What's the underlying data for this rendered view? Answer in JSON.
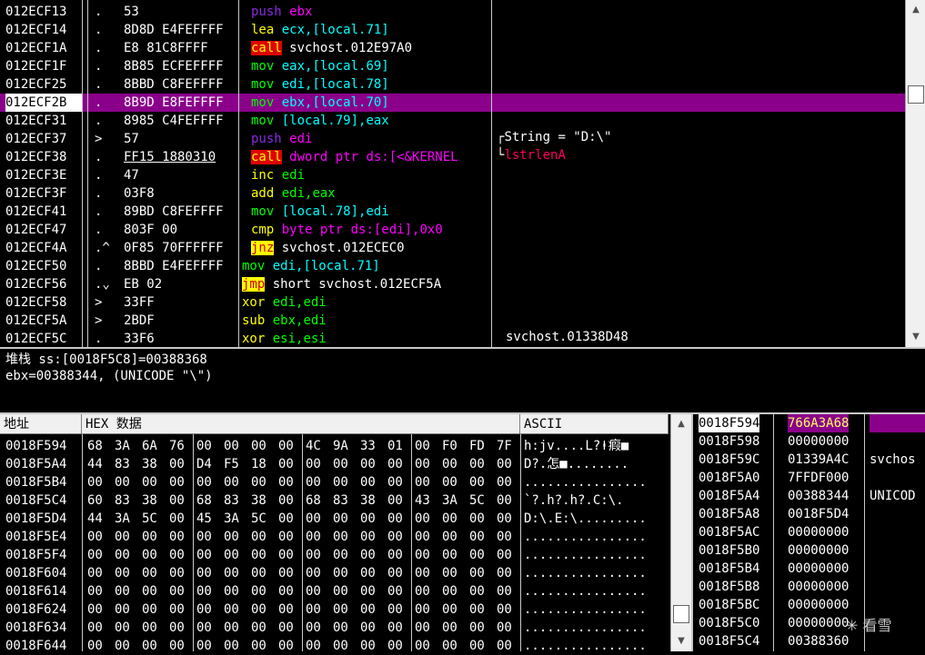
{
  "cpu": {
    "rows": [
      {
        "addr": "012ECF13",
        "mark": ".",
        "hex": "53",
        "op": "push",
        "opclass": "op-push",
        "args": "ebx",
        "argclass": "arg-mag"
      },
      {
        "addr": "012ECF14",
        "mark": ".",
        "hex": "8D8D E4FEFFFF",
        "op": "lea",
        "opclass": "op-cmp",
        "args": "ecx,[local.71]",
        "argclass": "arg-cyan"
      },
      {
        "addr": "012ECF1A",
        "mark": ".",
        "hex": "E8 81C8FFFF",
        "op": "call",
        "opclass": "op-call",
        "args": "svchost.012E97A0",
        "argclass": "arg-white"
      },
      {
        "addr": "012ECF1F",
        "mark": ".",
        "hex": "8B85 ECFEFFFF",
        "op": "mov",
        "opclass": "op-green",
        "args": "eax,[local.69]",
        "argclass": "arg-cyan"
      },
      {
        "addr": "012ECF25",
        "mark": ".",
        "hex": "8BBD C8FEFFFF",
        "op": "mov",
        "opclass": "op-green",
        "args": "edi,[local.78]",
        "argclass": "arg-cyan"
      },
      {
        "addr": "012ECF2B",
        "mark": ".",
        "hex": "8B9D E8FEFFFF",
        "op": "mov",
        "opclass": "op-green",
        "args": "ebx,[local.70]",
        "argclass": "arg-cyan"
      },
      {
        "addr": "012ECF31",
        "mark": ".",
        "hex": "8985 C4FEFFFF",
        "op": "mov",
        "opclass": "op-green",
        "args": "[local.79],eax",
        "argclass": "arg-cyan"
      },
      {
        "addr": "012ECF37",
        "mark": ">",
        "hex": "57",
        "op": "push",
        "opclass": "op-push",
        "args": "edi",
        "argclass": "arg-mag"
      },
      {
        "addr": "012ECF38",
        "mark": ".",
        "hex": "FF15 1880310",
        "op": "call",
        "opclass": "op-call",
        "args": "dword ptr ds:[<&KERNEL",
        "argclass": "arg-mag"
      },
      {
        "addr": "012ECF3E",
        "mark": ".",
        "hex": "47",
        "op": "inc",
        "opclass": "op-cmp",
        "args": "edi",
        "argclass": "arg-green"
      },
      {
        "addr": "012ECF3F",
        "mark": ".",
        "hex": "03F8",
        "op": "add",
        "opclass": "op-cmp",
        "args": "edi,eax",
        "argclass": "arg-green"
      },
      {
        "addr": "012ECF41",
        "mark": ".",
        "hex": "89BD C8FEFFFF",
        "op": "mov",
        "opclass": "op-green",
        "args": "[local.78],edi",
        "argclass": "arg-cyan"
      },
      {
        "addr": "012ECF47",
        "mark": ".",
        "hex": "803F 00",
        "op": "cmp",
        "opclass": "op-cmp",
        "args": "byte ptr ds:[edi],0x0",
        "argclass": "arg-mag"
      },
      {
        "addr": "012ECF4A",
        "mark": ".^",
        "hex": "0F85 70FFFFFF",
        "op": "jnz",
        "opclass": "op-jmp",
        "args": "svchost.012ECEC0",
        "argclass": "arg-white"
      },
      {
        "addr": "012ECF50",
        "mark": ".",
        "hex": "8BBD E4FEFFFF",
        "op": "mov",
        "opclass": "op-green",
        "args": "edi,[local.71]",
        "argclass": "arg-cyan"
      },
      {
        "addr": "012ECF56",
        "mark": ".⌄",
        "hex": "EB 02",
        "op": "jmp",
        "opclass": "op-jmp",
        "args": "short svchost.012ECF5A",
        "argclass": "arg-white"
      },
      {
        "addr": "012ECF58",
        "mark": ">",
        "hex": "33FF",
        "op": "xor",
        "opclass": "op-cmp",
        "args": "edi,edi",
        "argclass": "arg-green"
      },
      {
        "addr": "012ECF5A",
        "mark": ">",
        "hex": "2BDF",
        "op": "sub",
        "opclass": "op-cmp",
        "args": "ebx,edi",
        "argclass": "arg-green"
      },
      {
        "addr": "012ECF5C",
        "mark": ".",
        "hex": "33F6",
        "op": "xor",
        "opclass": "op-cmp",
        "args": "esi,esi",
        "argclass": "arg-green"
      }
    ],
    "comment_string": "String = \"D:\\\"",
    "comment_func": "lstrlenA",
    "comment_bottom": "svchost.01338D48"
  },
  "info": {
    "line1": "堆栈 ss:[0018F5C8]=00388368",
    "line2": "ebx=00388344, (UNICODE \"\\\")"
  },
  "dump": {
    "header_addr": "地址",
    "header_hex": "HEX 数据",
    "header_ascii": "ASCII",
    "rows": [
      {
        "addr": "0018F594",
        "bytes": [
          "68",
          "3A",
          "6A",
          "76",
          "00",
          "00",
          "00",
          "00",
          "4C",
          "9A",
          "33",
          "01",
          "00",
          "F0",
          "FD",
          "7F"
        ],
        "ascii": "h:jv....L?ⱡ瘕■"
      },
      {
        "addr": "0018F5A4",
        "bytes": [
          "44",
          "83",
          "38",
          "00",
          "D4",
          "F5",
          "18",
          "00",
          "00",
          "00",
          "00",
          "00",
          "00",
          "00",
          "00",
          "00"
        ],
        "ascii": "D?.怎■........"
      },
      {
        "addr": "0018F5B4",
        "bytes": [
          "00",
          "00",
          "00",
          "00",
          "00",
          "00",
          "00",
          "00",
          "00",
          "00",
          "00",
          "00",
          "00",
          "00",
          "00",
          "00"
        ],
        "ascii": "................"
      },
      {
        "addr": "0018F5C4",
        "bytes": [
          "60",
          "83",
          "38",
          "00",
          "68",
          "83",
          "38",
          "00",
          "68",
          "83",
          "38",
          "00",
          "43",
          "3A",
          "5C",
          "00"
        ],
        "ascii": "`?.h?.h?.C:\\."
      },
      {
        "addr": "0018F5D4",
        "bytes": [
          "44",
          "3A",
          "5C",
          "00",
          "45",
          "3A",
          "5C",
          "00",
          "00",
          "00",
          "00",
          "00",
          "00",
          "00",
          "00",
          "00"
        ],
        "ascii": "D:\\.E:\\........."
      },
      {
        "addr": "0018F5E4",
        "bytes": [
          "00",
          "00",
          "00",
          "00",
          "00",
          "00",
          "00",
          "00",
          "00",
          "00",
          "00",
          "00",
          "00",
          "00",
          "00",
          "00"
        ],
        "ascii": "................"
      },
      {
        "addr": "0018F5F4",
        "bytes": [
          "00",
          "00",
          "00",
          "00",
          "00",
          "00",
          "00",
          "00",
          "00",
          "00",
          "00",
          "00",
          "00",
          "00",
          "00",
          "00"
        ],
        "ascii": "................"
      },
      {
        "addr": "0018F604",
        "bytes": [
          "00",
          "00",
          "00",
          "00",
          "00",
          "00",
          "00",
          "00",
          "00",
          "00",
          "00",
          "00",
          "00",
          "00",
          "00",
          "00"
        ],
        "ascii": "................"
      },
      {
        "addr": "0018F614",
        "bytes": [
          "00",
          "00",
          "00",
          "00",
          "00",
          "00",
          "00",
          "00",
          "00",
          "00",
          "00",
          "00",
          "00",
          "00",
          "00",
          "00"
        ],
        "ascii": "................"
      },
      {
        "addr": "0018F624",
        "bytes": [
          "00",
          "00",
          "00",
          "00",
          "00",
          "00",
          "00",
          "00",
          "00",
          "00",
          "00",
          "00",
          "00",
          "00",
          "00",
          "00"
        ],
        "ascii": "................"
      },
      {
        "addr": "0018F634",
        "bytes": [
          "00",
          "00",
          "00",
          "00",
          "00",
          "00",
          "00",
          "00",
          "00",
          "00",
          "00",
          "00",
          "00",
          "00",
          "00",
          "00"
        ],
        "ascii": "................"
      },
      {
        "addr": "0018F644",
        "bytes": [
          "00",
          "00",
          "00",
          "00",
          "00",
          "00",
          "00",
          "00",
          "00",
          "00",
          "00",
          "00",
          "00",
          "00",
          "00",
          "00"
        ],
        "ascii": "................"
      }
    ]
  },
  "stack": {
    "rows": [
      {
        "addr": "0018F594",
        "val": "766A3A68",
        "com": ""
      },
      {
        "addr": "0018F598",
        "val": "00000000",
        "com": ""
      },
      {
        "addr": "0018F59C",
        "val": "01339A4C",
        "com": "svchos"
      },
      {
        "addr": "0018F5A0",
        "val": "7FFDF000",
        "com": ""
      },
      {
        "addr": "0018F5A4",
        "val": "00388344",
        "com": "UNICOD"
      },
      {
        "addr": "0018F5A8",
        "val": "0018F5D4",
        "com": ""
      },
      {
        "addr": "0018F5AC",
        "val": "00000000",
        "com": ""
      },
      {
        "addr": "0018F5B0",
        "val": "00000000",
        "com": ""
      },
      {
        "addr": "0018F5B4",
        "val": "00000000",
        "com": ""
      },
      {
        "addr": "0018F5B8",
        "val": "00000000",
        "com": ""
      },
      {
        "addr": "0018F5BC",
        "val": "00000000",
        "com": ""
      },
      {
        "addr": "0018F5C0",
        "val": "00000000",
        "com": ""
      },
      {
        "addr": "0018F5C4",
        "val": "00388360",
        "com": ""
      }
    ]
  },
  "watermark": "看雪",
  "colors": {
    "selection": "#8a008a",
    "call_bg": "#e00000",
    "jmp_bg": "#ffff00"
  }
}
